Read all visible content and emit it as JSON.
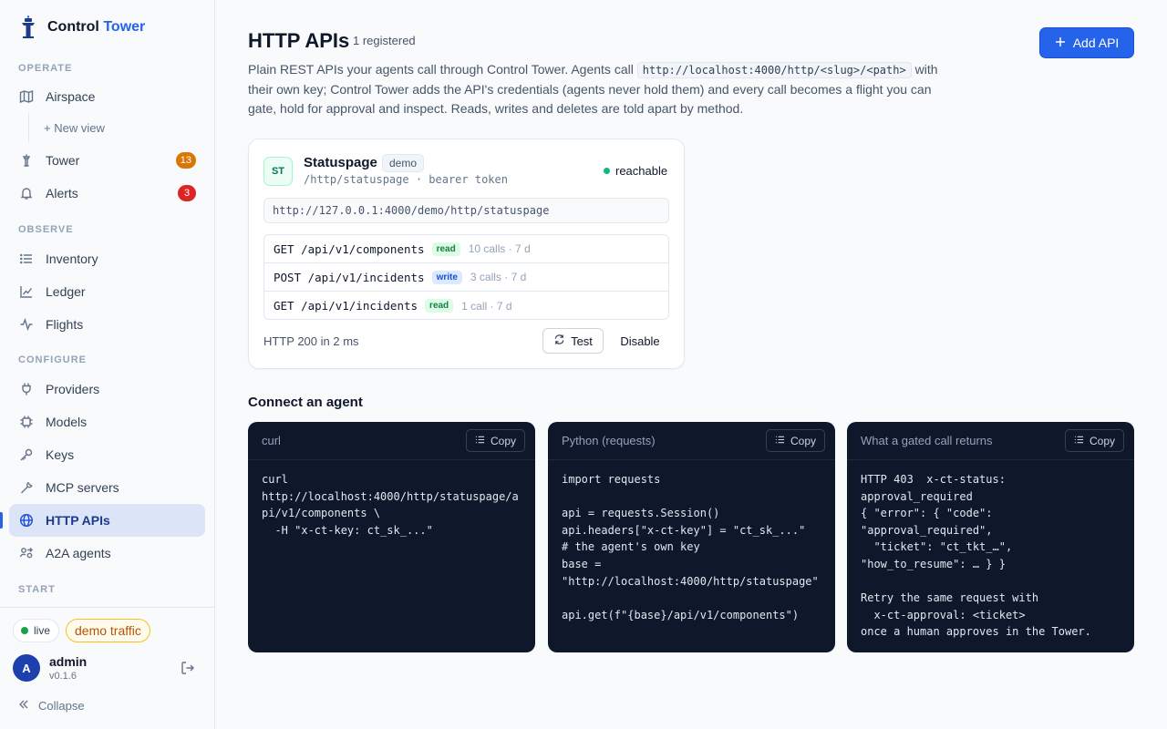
{
  "brand": {
    "name": "Control",
    "accent": "Tower"
  },
  "sidebar": {
    "sections": {
      "operate": "OPERATE",
      "observe": "OBSERVE",
      "configure": "CONFIGURE",
      "start": "START"
    },
    "items": {
      "airspace": "Airspace",
      "new_view": "+ New view",
      "tower": "Tower",
      "tower_badge": "13",
      "alerts": "Alerts",
      "alerts_badge": "3",
      "inventory": "Inventory",
      "ledger": "Ledger",
      "flights": "Flights",
      "providers": "Providers",
      "models": "Models",
      "keys": "Keys",
      "mcp": "MCP servers",
      "http_apis": "HTTP APIs",
      "a2a": "A2A agents"
    },
    "footer": {
      "live": "live",
      "demo": "demo traffic",
      "avatar_letter": "A",
      "user": "admin",
      "version": "v0.1.6",
      "collapse": "Collapse"
    }
  },
  "header": {
    "title": "HTTP APIs",
    "count": "1 registered",
    "add_button": "Add API",
    "desc_1": "Plain REST APIs your agents call through Control Tower. Agents call ",
    "desc_code": "http://localhost:4000/http/<slug>/<path>",
    "desc_2": " with their own key; Control Tower adds the API's credentials (agents never hold them) and every call becomes a flight you can gate, hold for approval and inspect. Reads, writes and deletes are told apart by method."
  },
  "api_card": {
    "logo": "ST",
    "name": "Statuspage",
    "tag": "demo",
    "path": "/http/statuspage · bearer token",
    "status": "reachable",
    "url": "http://127.0.0.1:4000/demo/http/statuspage",
    "routes": [
      {
        "route": "GET /api/v1/components",
        "kind": "read",
        "calls": "10 calls · 7 d"
      },
      {
        "route": "POST /api/v1/incidents",
        "kind": "write",
        "calls": "3 calls · 7 d"
      },
      {
        "route": "GET /api/v1/incidents",
        "kind": "read",
        "calls": "1 call · 7 d"
      }
    ],
    "result": "HTTP 200 in 2 ms",
    "test_button": "Test",
    "disable_button": "Disable"
  },
  "connect": {
    "title": "Connect an agent",
    "copy_label": "Copy",
    "snippets": [
      {
        "title": "curl",
        "code": "curl\nhttp://localhost:4000/http/statuspage/api/v1/components \\\n  -H \"x-ct-key: ct_sk_...\""
      },
      {
        "title": "Python (requests)",
        "code": "import requests\n\napi = requests.Session()\napi.headers[\"x-ct-key\"] = \"ct_sk_...\"\n# the agent's own key\nbase =\n\"http://localhost:4000/http/statuspage\"\n\napi.get(f\"{base}/api/v1/components\")"
      },
      {
        "title": "What a gated call returns",
        "code": "HTTP 403  x-ct-status:\napproval_required\n{ \"error\": { \"code\":\n\"approval_required\",\n  \"ticket\": \"ct_tkt_…\",\n\"how_to_resume\": … } }\n\nRetry the same request with\n  x-ct-approval: <ticket>\nonce a human approves in the Tower."
      }
    ]
  },
  "colors": {
    "accent": "#2563eb",
    "sidebar_active": "#dbe5f7",
    "code_bg": "#0f172a",
    "reachable": "#10b981",
    "warning_badge": "#d97706",
    "alert_badge": "#dc2626"
  }
}
